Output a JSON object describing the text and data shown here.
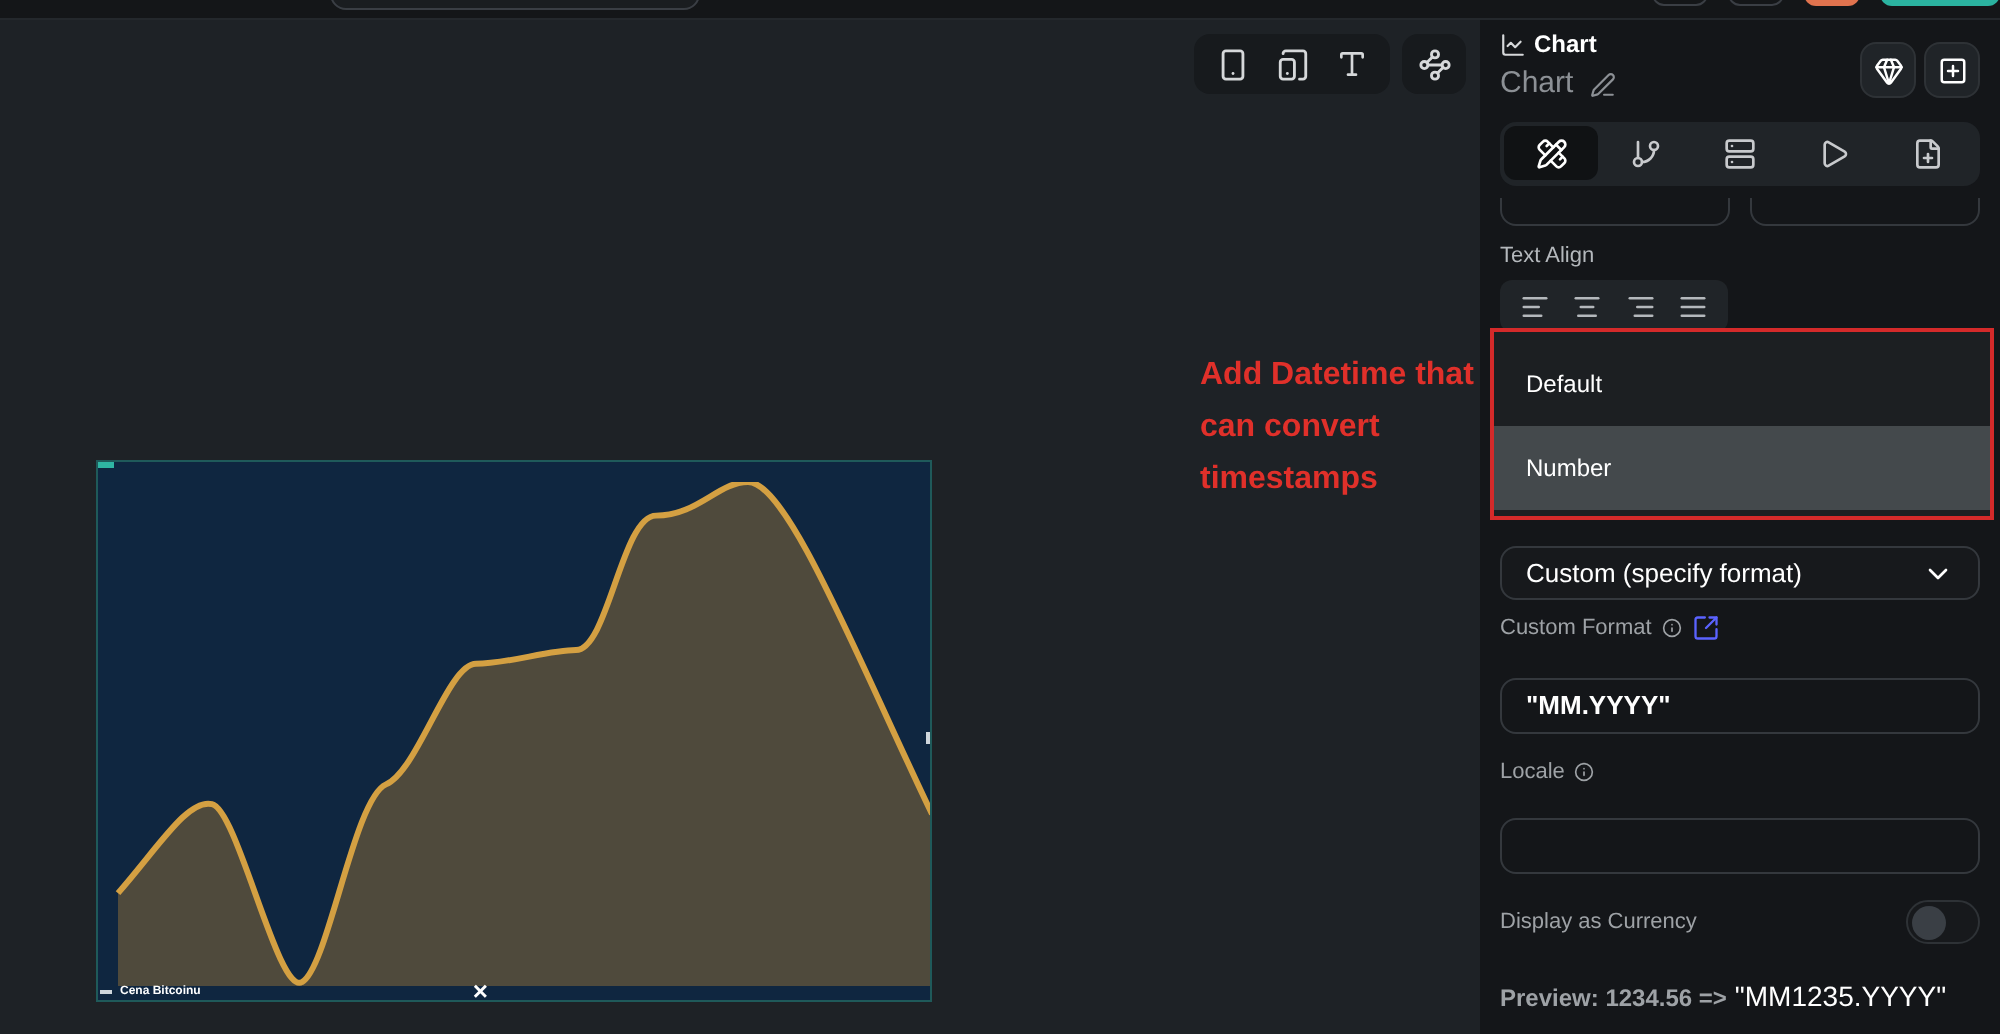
{
  "annotation": {
    "text": "Add Datetime that can convert timestamps"
  },
  "chart_widget": {
    "legend": "Cena Bitcoinu",
    "close": "×"
  },
  "panel": {
    "type_label": "Chart",
    "name": "Chart",
    "tabs": [
      {
        "kind": "design",
        "selected": true
      },
      {
        "kind": "flow",
        "selected": false
      },
      {
        "kind": "data",
        "selected": false
      },
      {
        "kind": "play",
        "selected": false
      },
      {
        "kind": "notes",
        "selected": false
      }
    ],
    "text_align_label": "Text Align",
    "align_buttons": [
      {
        "kind": "left",
        "selected": false
      },
      {
        "kind": "center",
        "selected": false
      },
      {
        "kind": "right",
        "selected": false
      },
      {
        "kind": "justify",
        "selected": false
      }
    ],
    "dropdown_options": [
      {
        "label": "Default",
        "selected": false
      },
      {
        "label": "Number",
        "selected": true
      }
    ],
    "format_select": {
      "value": "Custom (specify format)"
    },
    "custom_format": {
      "label": "Custom Format",
      "value": "\"MM.YYYY\""
    },
    "locale": {
      "label": "Locale"
    },
    "currency": {
      "label": "Display as Currency",
      "on": false
    },
    "preview": {
      "label": "Preview: 1234.56 =>",
      "value": "\"MM1235.YYYY\""
    }
  }
}
